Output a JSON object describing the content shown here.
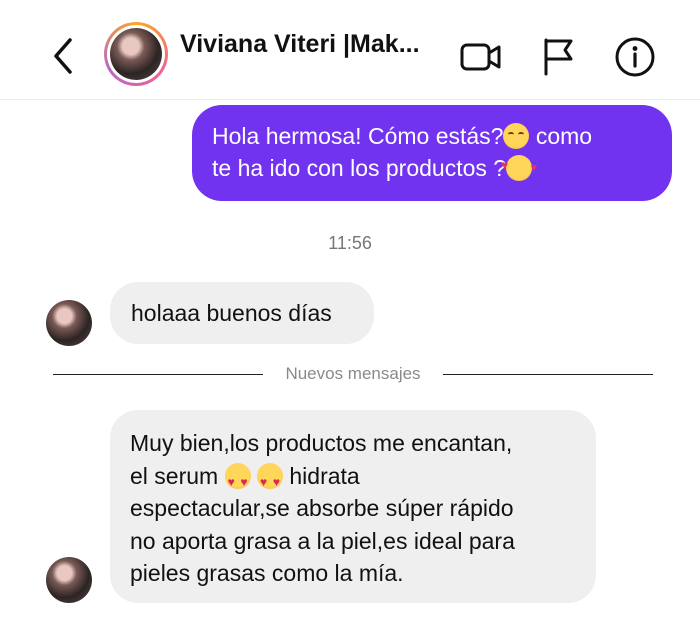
{
  "header": {
    "contact_name": "Viviana Viteri |Mak...",
    "icons": [
      "back-chevron-icon",
      "video-camera-icon",
      "flag-icon",
      "info-icon"
    ]
  },
  "messages": {
    "outgoing_1": {
      "line1_text": "Hola hermosa! Cómo estás?",
      "line1_emoji": "smiling-blush-emoji",
      "line1_tail": " como",
      "line2_text": "te ha ido con los productos ?",
      "line2_emoji": "smiling-face-with-hearts-emoji"
    },
    "timestamp": "11:56",
    "incoming_1": "holaaa buenos días",
    "divider_label": "Nuevos mensajes",
    "incoming_2": {
      "line1": "Muy bien,los productos me encantan,",
      "line2_start": "el serum ",
      "line2_emoji": "heart-eyes-emoji",
      "line2_end": " hidrata",
      "line3": "espectacular,se absorbe súper rápido",
      "line4": "no aporta grasa a la piel,es ideal para",
      "line5": "pieles grasas como la mía."
    }
  },
  "colors": {
    "outgoing_bubble": "#7233f0",
    "incoming_bubble": "#efefef",
    "accent_ring": "#f06292"
  }
}
